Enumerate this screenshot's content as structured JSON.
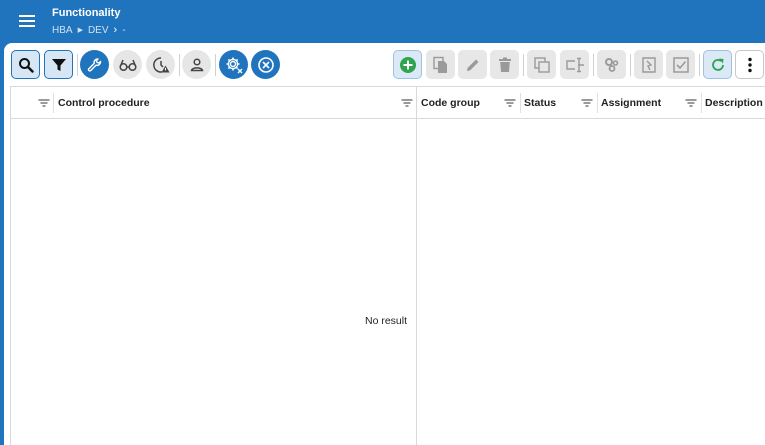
{
  "header": {
    "menu_icon": "hamburger-icon",
    "title": "Functionality",
    "breadcrumb": [
      "HBA",
      "DEV",
      "-"
    ]
  },
  "toolbar": {
    "left_buttons": [
      {
        "icon": "search-icon",
        "state": "selected"
      },
      {
        "icon": "filter-icon",
        "state": "selected"
      },
      {
        "icon": "wrench-icon",
        "state": "active"
      },
      {
        "icon": "glasses-icon",
        "state": "inactive"
      },
      {
        "icon": "clock-warning-icon",
        "state": "inactive"
      },
      {
        "icon": "person-icon",
        "state": "inactive"
      },
      {
        "icon": "gear-close-icon",
        "state": "active"
      },
      {
        "icon": "close-circle-icon",
        "state": "active"
      }
    ],
    "right_buttons": [
      {
        "icon": "add-icon",
        "state": "enabled"
      },
      {
        "icon": "copy-document-icon",
        "state": "disabled"
      },
      {
        "icon": "edit-icon",
        "state": "disabled"
      },
      {
        "icon": "delete-icon",
        "state": "disabled"
      },
      {
        "icon": "duplicate-icon",
        "state": "disabled"
      },
      {
        "icon": "rename-icon",
        "state": "disabled"
      },
      {
        "icon": "gears-icon",
        "state": "disabled"
      },
      {
        "icon": "assign-icon",
        "state": "disabled"
      },
      {
        "icon": "checkbox-icon",
        "state": "disabled"
      },
      {
        "icon": "refresh-icon",
        "state": "enabled"
      },
      {
        "icon": "more-vertical-icon",
        "state": "enabled"
      }
    ]
  },
  "left_grid": {
    "columns": [
      "Control procedure"
    ],
    "empty_text": "No result"
  },
  "right_grid": {
    "columns": [
      "Code group",
      "Status",
      "Assignment",
      "Description"
    ]
  },
  "colors": {
    "brand": "#1f74bd",
    "disabled_button": "#e7e7e7",
    "add_green": "#2ea44f"
  }
}
